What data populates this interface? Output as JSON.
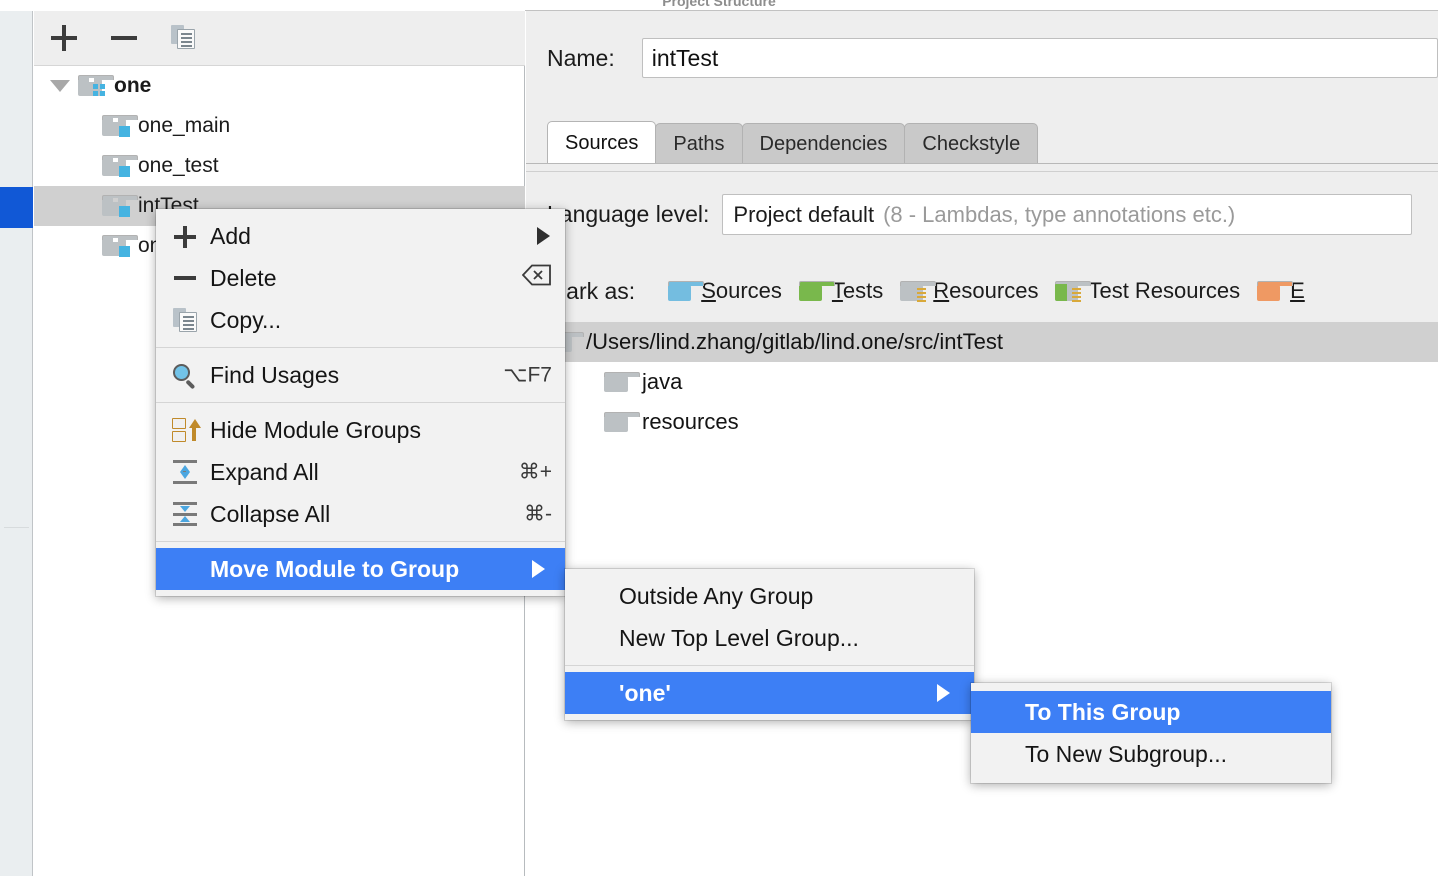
{
  "window": {
    "title": "Project Structure"
  },
  "tree_toolbar": {
    "add_tooltip": "Add",
    "remove_tooltip": "Remove",
    "copy_tooltip": "Copy"
  },
  "module_tree": {
    "rows": [
      {
        "label": "one",
        "kind": "group",
        "depth": 0,
        "expanded": true,
        "bold": true,
        "selected": false
      },
      {
        "label": "one_main",
        "kind": "module",
        "depth": 1,
        "selected": false
      },
      {
        "label": "one_test",
        "kind": "module",
        "depth": 1,
        "selected": false
      },
      {
        "label": "intTest",
        "kind": "module",
        "depth": 1,
        "selected": true
      },
      {
        "label": "one",
        "kind": "module",
        "depth": 1,
        "selected": false
      }
    ]
  },
  "detail": {
    "name_label": "Name:",
    "name_value": "intTest",
    "tabs": [
      {
        "label": "Sources",
        "active": true
      },
      {
        "label": "Paths",
        "active": false
      },
      {
        "label": "Dependencies",
        "active": false
      },
      {
        "label": "Checkstyle",
        "active": false
      }
    ],
    "language_level": {
      "label": "Language level:",
      "primary": "Project default",
      "secondary": "(8 - Lambdas, type annotations etc.)"
    },
    "mark_as": {
      "label": "Mark as:",
      "items": [
        {
          "label": "Sources",
          "mnemonic": "S",
          "rest": "ources",
          "color": "#74bde0",
          "style": "plain"
        },
        {
          "label": "Tests",
          "mnemonic": "T",
          "rest": "ests",
          "color": "#79b84c",
          "style": "plain"
        },
        {
          "label": "Resources",
          "mnemonic": "R",
          "rest": "esources",
          "color": "#bcc1c4",
          "style": "lines"
        },
        {
          "label": "Test Resources",
          "mnemonic": "",
          "rest": "Test Resources",
          "color": "#bcc1c4",
          "style": "lines-green"
        },
        {
          "label": "Excluded",
          "mnemonic": "E",
          "rest": "",
          "color": "#ef9963",
          "style": "plain"
        }
      ]
    },
    "paths": [
      {
        "label": "/Users/lind.zhang/gitlab/lind.one/src/intTest",
        "selected": true,
        "child": false
      },
      {
        "label": "java",
        "selected": false,
        "child": true
      },
      {
        "label": "resources",
        "selected": false,
        "child": true
      }
    ]
  },
  "context_menu": {
    "items": [
      {
        "label": "Add",
        "icon": "plus-icon",
        "accel": "",
        "arrow": true,
        "highlight": false
      },
      {
        "label": "Delete",
        "icon": "minus-icon",
        "accel": "⌫",
        "arrow": false,
        "highlight": false
      },
      {
        "label": "Copy...",
        "icon": "copy-icon",
        "accel": "",
        "arrow": false,
        "highlight": false
      },
      {
        "separator": true
      },
      {
        "label": "Find Usages",
        "icon": "magnifier-icon",
        "accel": "⌥F7",
        "arrow": false,
        "highlight": false
      },
      {
        "separator": true
      },
      {
        "label": "Hide Module Groups",
        "icon": "hide-groups-icon",
        "accel": "",
        "arrow": false,
        "highlight": false
      },
      {
        "label": "Expand All",
        "icon": "expand-all-icon",
        "accel": "⌘+",
        "arrow": false,
        "highlight": false
      },
      {
        "label": "Collapse All",
        "icon": "collapse-all-icon",
        "accel": "⌘-",
        "arrow": false,
        "highlight": false
      },
      {
        "separator": true
      },
      {
        "label": "Move Module to Group",
        "icon": "",
        "accel": "",
        "arrow": true,
        "highlight": true
      }
    ]
  },
  "submenu_group": {
    "items": [
      {
        "label": "Outside Any Group",
        "arrow": false,
        "highlight": false
      },
      {
        "label": "New Top Level Group...",
        "arrow": false,
        "highlight": false
      },
      {
        "separator": true
      },
      {
        "label": "'one'",
        "arrow": true,
        "highlight": true
      }
    ]
  },
  "submenu_one": {
    "items": [
      {
        "label": "To This Group",
        "highlight": true
      },
      {
        "label": "To New Subgroup...",
        "highlight": false
      }
    ]
  },
  "colors": {
    "highlight_blue": "#3d7ff5",
    "rail_selection_blue": "#1158d6",
    "row_selection_gray": "#d0d0d0",
    "menu_background": "#f2f2f2"
  }
}
